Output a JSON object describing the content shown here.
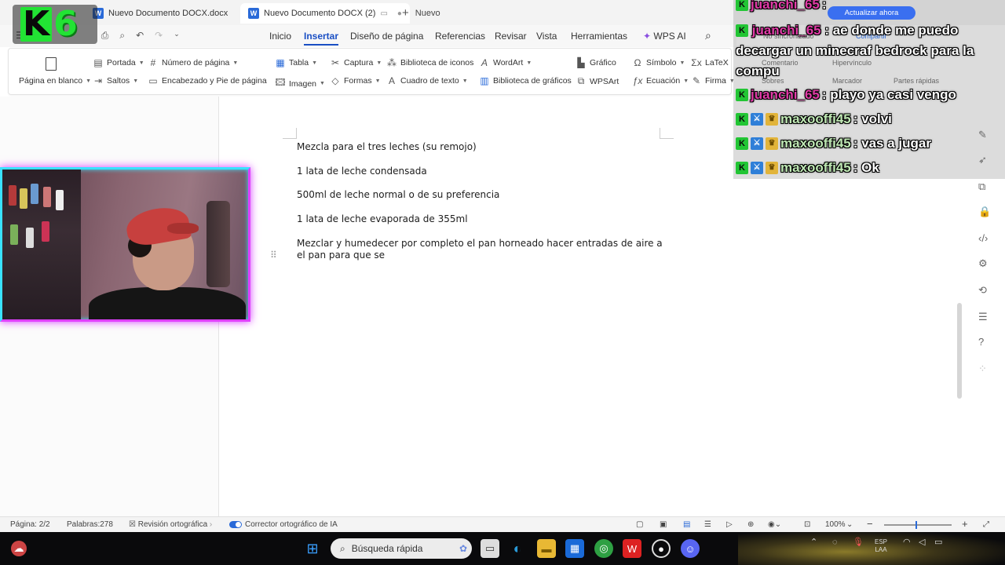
{
  "tabs": [
    {
      "icon": "W",
      "label": "Nuevo Documento DOCX.docx",
      "close": "●"
    },
    {
      "icon": "W",
      "label": "Nuevo Documento DOCX (2)",
      "close": "●"
    }
  ],
  "new_tab_label": "Nuevo",
  "menu": [
    "Inicio",
    "Insertar",
    "Diseño de página",
    "Referencias",
    "Revisar",
    "Vista",
    "Herramientas",
    "WPS AI"
  ],
  "ribbon": {
    "blank_page": "Página en blanco",
    "cover": "Portada",
    "breaks": "Saltos",
    "page_number": "Número de página",
    "header_footer": "Encabezado y Pie de página",
    "table": "Tabla",
    "image": "Imagen",
    "capture": "Captura",
    "shapes": "Formas",
    "icon_library": "Biblioteca de iconos",
    "textbox": "Cuadro  de texto",
    "wordart": "WordArt",
    "chart_library": "Biblioteca de gráficos",
    "chart": "Gráfico",
    "wpsart": "WPSArt",
    "symbol": "Símbolo",
    "equation": "Ecuación",
    "latex": "LaTeX",
    "signature": "Firma"
  },
  "document": {
    "paragraphs": [
      "Mezcla para el tres leches (su remojo)",
      "1 lata de leche condensada",
      "500ml de leche normal o de su preferencia",
      "1 lata de leche evaporada de 355ml",
      "Mezclar y humedecer por completo el pan horneado hacer entradas de aire a el pan para que se"
    ]
  },
  "behind_chat": {
    "update_button": "Actualizar ahora",
    "not_synced": "No sincronizado",
    "share": "Compartir",
    "comment": "Comentario",
    "hyperlink": "Hipervínculo",
    "envelopes": "Sobres",
    "bookmark": "Marcador",
    "quick_parts": "Partes rápidas"
  },
  "logo_text": [
    "K",
    "6"
  ],
  "chat": [
    {
      "user": "juanchi_65",
      "message": ":",
      "badges": [
        "K"
      ],
      "color": "#e23ca8"
    },
    {
      "user": "juanchi_65",
      "message": ": ae donde me puedo decargar un minecraf bedrock para la compu",
      "badges": [
        "K"
      ],
      "color": "#e23ca8"
    },
    {
      "user": "juanchi_65",
      "message": ": playo ya casi vengo",
      "badges": [
        "K"
      ],
      "color": "#e23ca8"
    },
    {
      "user": "maxooffi45",
      "message": ": volvi",
      "badges": [
        "K",
        "mod",
        "crown"
      ],
      "color": "#bfe8b4"
    },
    {
      "user": "maxooffi45",
      "message": ": vas a jugar",
      "badges": [
        "K",
        "mod",
        "crown"
      ],
      "color": "#bfe8b4"
    },
    {
      "user": "maxooffi45",
      "message": ": Ok",
      "badges": [
        "K",
        "mod",
        "crown"
      ],
      "color": "#bfe8b4"
    }
  ],
  "status": {
    "page": "Página: 2/2",
    "words": "Palabras:278",
    "spellcheck": "Revisión ortográfica",
    "ai_corrector": "Corrector ortográfico de IA",
    "zoom": "100%"
  },
  "taskbar": {
    "search_placeholder": "Búsqueda rápida",
    "lang_top": "ESP",
    "lang_bottom": "LAA"
  },
  "colors": {
    "accent": "#1a4fc4",
    "webcam_border_top": "#39e2ff",
    "webcam_border_bottom": "#e040ff",
    "logo_green": "#22e334"
  }
}
